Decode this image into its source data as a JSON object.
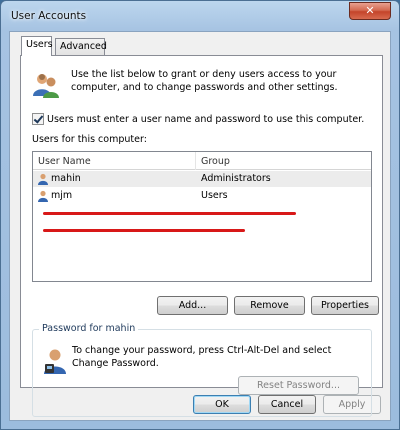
{
  "window": {
    "title": "User Accounts",
    "close_glyph": "✕"
  },
  "tabs": [
    {
      "label": "Users",
      "active": true
    },
    {
      "label": "Advanced",
      "active": false
    }
  ],
  "intro": {
    "icon": "users-icon",
    "text": "Use the list below to grant or deny users access to your computer, and to change passwords and other settings."
  },
  "require_login": {
    "checked": true,
    "label": "Users must enter a user name and password to use this computer."
  },
  "users_section": {
    "label": "Users for this computer:",
    "columns": [
      "User Name",
      "Group"
    ],
    "rows": [
      {
        "name": "mahin",
        "group": "Administrators",
        "selected": true,
        "icon": "user-icon"
      },
      {
        "name": "mjm",
        "group": "Users",
        "selected": false,
        "icon": "user-icon"
      }
    ]
  },
  "list_buttons": {
    "add": "Add...",
    "remove": "Remove",
    "properties": "Properties"
  },
  "password_group": {
    "title": "Password for mahin",
    "icon": "key-user-icon",
    "text": "To change your password, press Ctrl-Alt-Del and select Change Password.",
    "reset_button": "Reset Password..."
  },
  "dialog_buttons": {
    "ok": "OK",
    "cancel": "Cancel",
    "apply": "Apply"
  },
  "colors": {
    "annotation": "#d81818",
    "selection": "#ececec",
    "title_gradient_top": "#bcd6ee"
  }
}
